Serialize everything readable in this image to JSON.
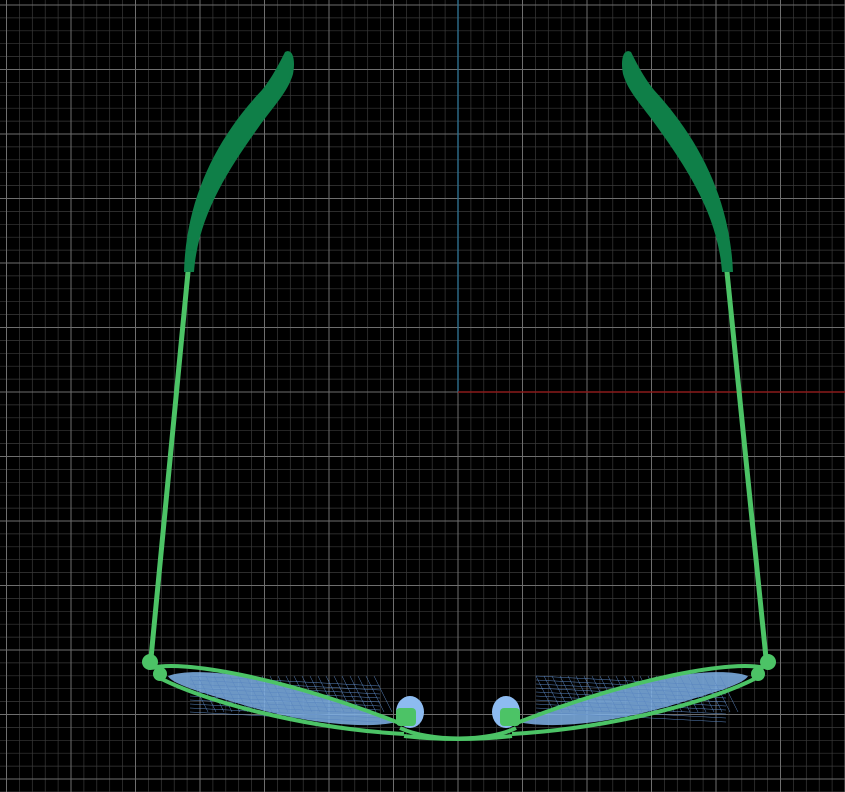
{
  "viewport": {
    "view": "top",
    "background_color": "#000000",
    "grid": {
      "visible": true,
      "minor_color": "#3a3a3a",
      "major_color": "#6e6e6e"
    },
    "axes": {
      "x_axis_color": "#8b1a1a",
      "y_axis_color": "#2e6f8e"
    }
  },
  "model": {
    "object": "eyeglasses",
    "temple_tip_color": "#0f7f48",
    "frame_color": "#4cc366",
    "lens_color": "#7fb2e8",
    "nose_pad_color": "#8dbbf0",
    "lens_mesh_color": "#5a86c0"
  }
}
